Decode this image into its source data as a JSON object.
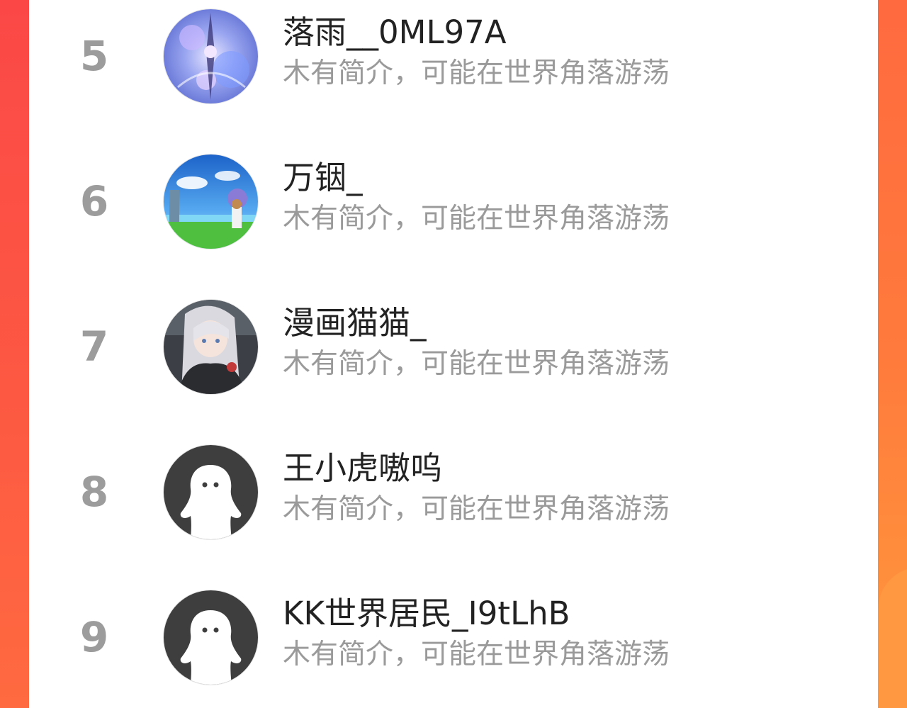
{
  "colors": {
    "accent_left": "#fb4a44",
    "accent_right": "#ff8a3a",
    "rank_number": "#9c9c9c",
    "username": "#222222",
    "bio": "#9a9a9a"
  },
  "rank_list": {
    "items": [
      {
        "rank": "5",
        "username": "落雨__0ML97A",
        "bio": "木有简介，可能在世界角落游荡",
        "avatar": "anime-blue-avatar"
      },
      {
        "rank": "6",
        "username": "万铟_",
        "bio": "木有简介，可能在世界角落游荡",
        "avatar": "sky-landscape-avatar"
      },
      {
        "rank": "7",
        "username": "漫画猫猫_",
        "bio": "木有简介，可能在世界角落游荡",
        "avatar": "anime-girl-avatar"
      },
      {
        "rank": "8",
        "username": "王小虎嗷呜",
        "bio": "木有简介，可能在世界角落游荡",
        "avatar": "default-user-avatar"
      },
      {
        "rank": "9",
        "username": "KK世界居民_I9tLhB",
        "bio": "木有简介，可能在世界角落游荡",
        "avatar": "default-user-avatar"
      }
    ]
  }
}
